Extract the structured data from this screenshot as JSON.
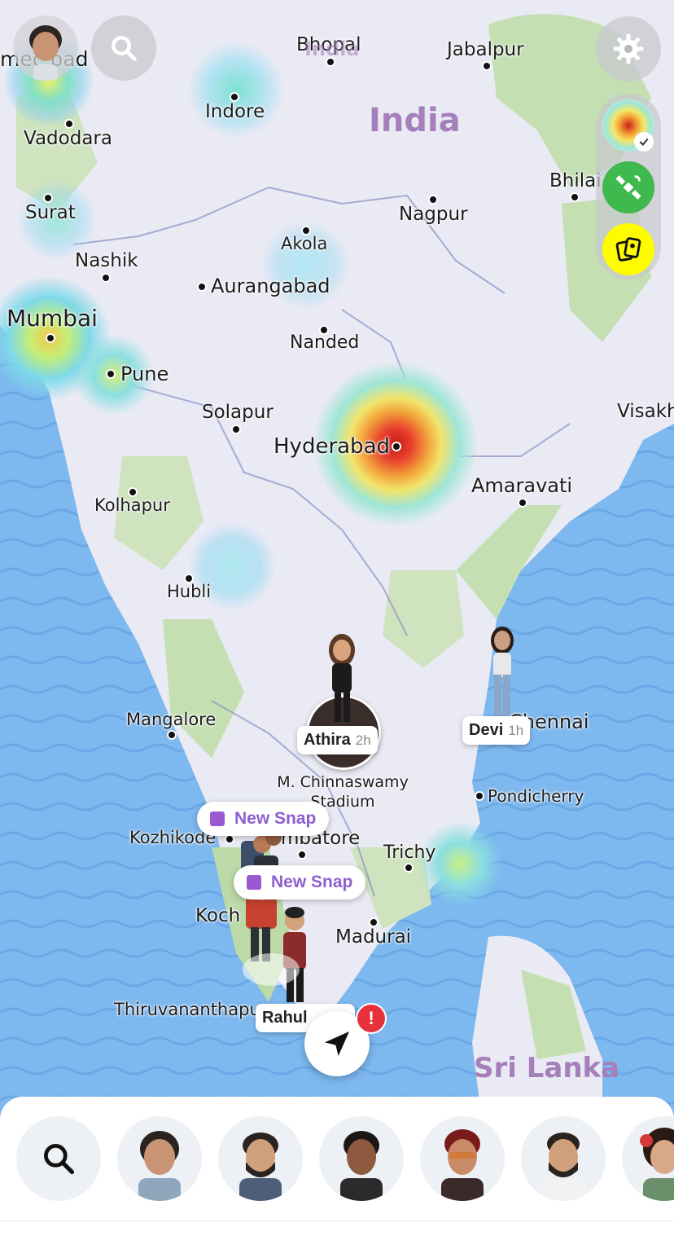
{
  "map": {
    "countries": {
      "india": "India",
      "sri_lanka": "Sri Lanka",
      "top_overlap": "India"
    },
    "cities": {
      "ahmedabad": "mec bad",
      "bhopal": "Bhopal",
      "jabalpur": "Jabalpur",
      "indore": "Indore",
      "vadodara": "Vadodara",
      "bhilai": "Bhilai",
      "surat": "Surat",
      "nagpur": "Nagpur",
      "akola": "Akola",
      "nashik": "Nashik",
      "aurangabad": "Aurangabad",
      "mumbai": "Mumbai",
      "nanded": "Nanded",
      "pune": "Pune",
      "solapur": "Solapur",
      "visakhapatnam": "Visakh",
      "hyderabad": "Hyderabad",
      "amaravati": "Amaravati",
      "kolhapur": "Kolhapur",
      "hubli": "Hubli",
      "mangalore": "Mangalore",
      "chennai": "Chennai",
      "stadium": "M. Chinnaswamy Stadium",
      "pondicherry": "Pondicherry",
      "kozhikode": "Kozhikode",
      "coimbatore": "mbatore",
      "trichy": "Trichy",
      "kochi": "Koch",
      "madurai": "Madurai",
      "thiruvananthapuram": "Thiruvananthapu"
    }
  },
  "friends_on_map": [
    {
      "name": "Athira",
      "time": "2h"
    },
    {
      "name": "Devi",
      "time": "1h"
    },
    {
      "name": "Rahul"
    }
  ],
  "snaps": {
    "snap1": "New Snap",
    "snap2": "New Snap"
  },
  "controls": {
    "alert_badge": "!",
    "heat_color": "#e8402e",
    "snap_yellow": "#fffc00",
    "satellite_green": "#3fb84d"
  },
  "icons": {
    "search": "search-icon",
    "settings": "gear-icon",
    "heatmap": "heatmap-icon",
    "satellite": "satellite-icon",
    "memories": "memories-icon",
    "locate": "navigation-arrow-icon"
  }
}
